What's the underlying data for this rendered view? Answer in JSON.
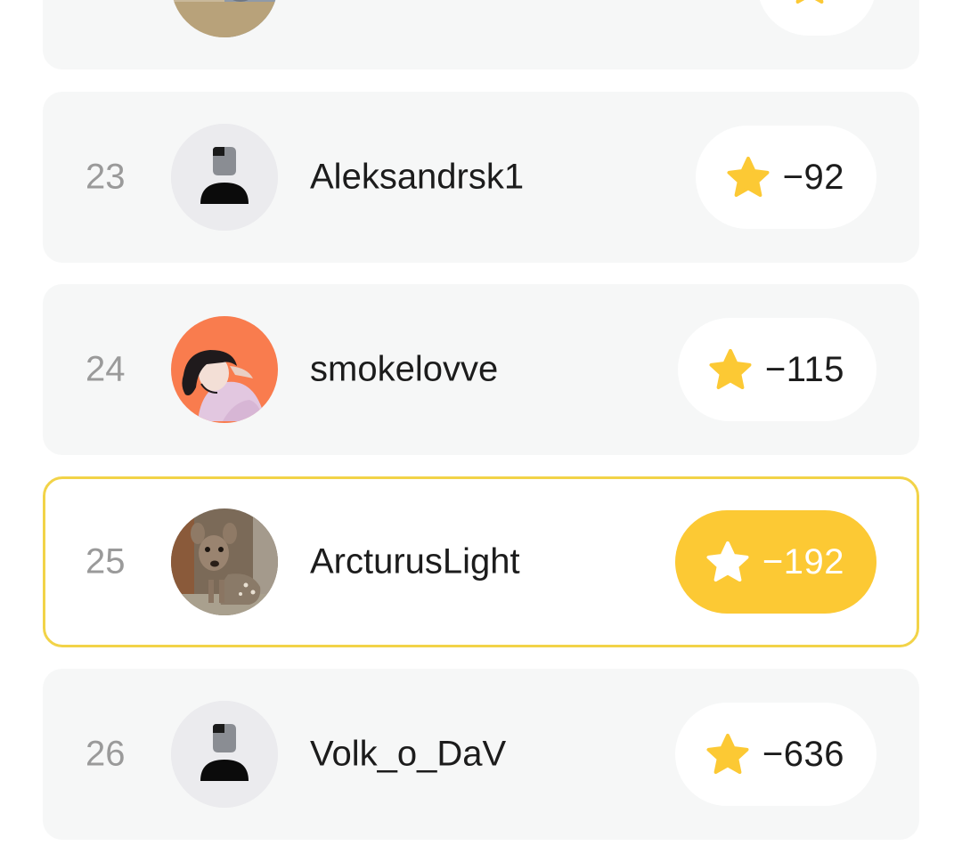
{
  "colors": {
    "star_yellow": "#fcc934",
    "highlight_border": "#f2d348",
    "row_background": "#f6f7f7"
  },
  "leaderboard": [
    {
      "rank": "23",
      "username": "Aleksandrsk1",
      "score": "−92",
      "avatar": "default-user-icon",
      "highlighted": false
    },
    {
      "rank": "24",
      "username": "smokelovve",
      "score": "−115",
      "avatar": "anime-girl-photo",
      "highlighted": false
    },
    {
      "rank": "25",
      "username": "ArcturusLight",
      "score": "−192",
      "avatar": "fawn-photo",
      "highlighted": true
    },
    {
      "rank": "26",
      "username": "Volk_o_DaV",
      "score": "−636",
      "avatar": "default-user-icon",
      "highlighted": false
    }
  ]
}
